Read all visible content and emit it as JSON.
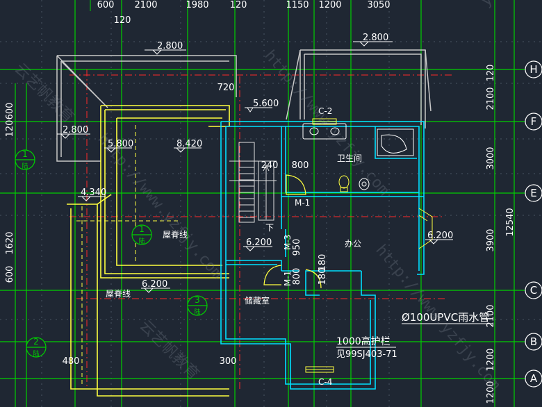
{
  "colors": {
    "background": "#1f2733",
    "grid": "#00d000",
    "axis_red": "#ff2a2a",
    "wall_cyan": "#00e0ff",
    "roof_yellow": "#ffff40",
    "text_white": "#ffffff",
    "gray_line": "#c8c8c8"
  },
  "top_dimensions": [
    "600",
    "2100",
    "1980",
    "120",
    "1150",
    "1200",
    "3050",
    "120"
  ],
  "right_dimensions": [
    "120",
    "2100",
    "3000",
    "3900",
    "12540",
    "2100",
    "1200",
    "1200"
  ],
  "left_dimensions": [
    "120",
    "600",
    "1620",
    "600"
  ],
  "axis_labels": [
    "H",
    "F",
    "E",
    "C",
    "B",
    "A"
  ],
  "elevations": [
    "2.800",
    "2.800",
    "5.600",
    "2.800",
    "5.800",
    "8.420",
    "4.340",
    "6.200",
    "6.200",
    "6.200"
  ],
  "small_dims": [
    "720",
    "240",
    "800",
    "950",
    "180",
    "180",
    "800",
    "480",
    "300"
  ],
  "room_labels": {
    "bathroom": "卫生间",
    "office": "办公",
    "storage": "储藏室",
    "down": "下",
    "ridge_line_1": "屋脊线",
    "ridge_line_2": "屋脊线"
  },
  "window_labels": [
    "C-2",
    "C-4"
  ],
  "door_labels": [
    "M-1",
    "M-3",
    "M-1"
  ],
  "detail_tags": [
    {
      "num": "1",
      "ref": "陆"
    },
    {
      "num": "1",
      "ref": "陆"
    },
    {
      "num": "3",
      "ref": "陆"
    },
    {
      "num": "2",
      "ref": "陆"
    }
  ],
  "notes": {
    "pipe": "Ø100UPVC雨水管",
    "railing": "1000高护栏",
    "railing_ref": "见99SJ403-71"
  },
  "watermarks": [
    "http://www.yzfjy.com",
    "http://www.yzfjy.com",
    "http://www.yzfjy.com",
    "云艺帆教育",
    "云艺帆教育",
    "yzfjy"
  ]
}
